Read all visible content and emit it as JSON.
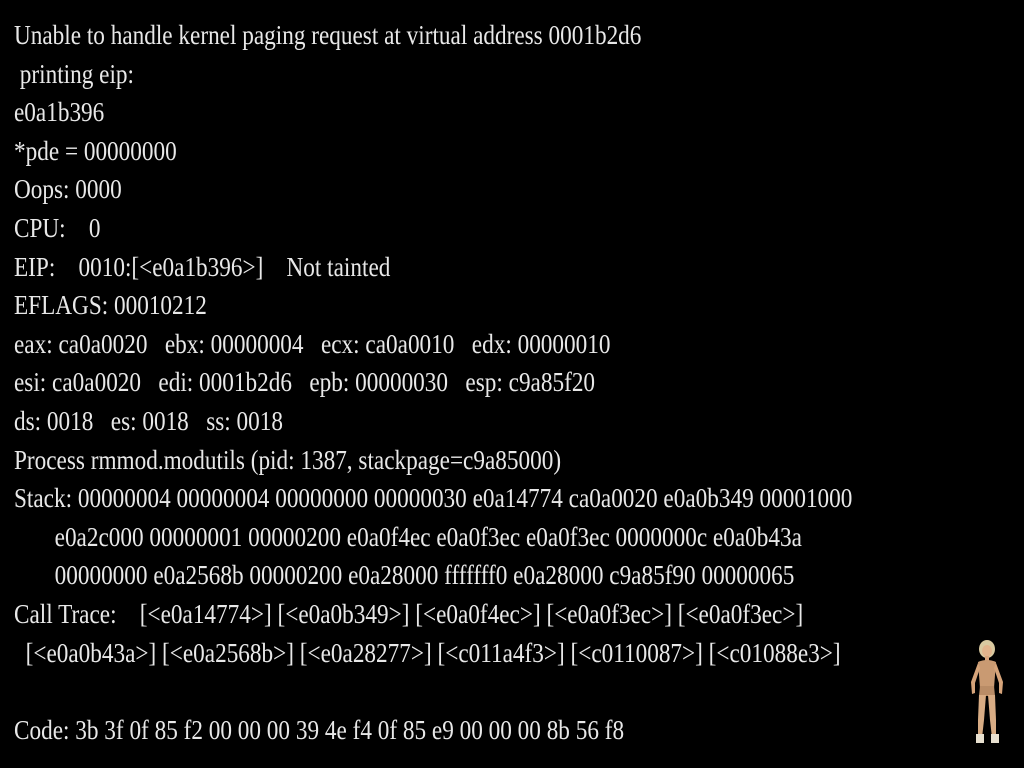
{
  "console": {
    "lines": [
      "Unable to handle kernel paging request at virtual address 0001b2d6",
      " printing eip:",
      "e0a1b396",
      "*pde = 00000000",
      "Oops: 0000",
      "CPU:    0",
      "EIP:    0010:[<e0a1b396>]    Not tainted",
      "EFLAGS: 00010212",
      "eax: ca0a0020   ebx: 00000004   ecx: ca0a0010   edx: 00000010",
      "esi: ca0a0020   edi: 0001b2d6   epb: 00000030   esp: c9a85f20",
      "ds: 0018   es: 0018   ss: 0018",
      "Process rmmod.modutils (pid: 1387, stackpage=c9a85000)",
      "Stack: 00000004 00000004 00000000 00000030 e0a14774 ca0a0020 e0a0b349 00001000",
      "       e0a2c000 00000001 00000200 e0a0f4ec e0a0f3ec e0a0f3ec 0000000c e0a0b43a",
      "       00000000 e0a2568b 00000200 e0a28000 fffffff0 e0a28000 c9a85f90 00000065",
      "Call Trace:    [<e0a14774>] [<e0a0b349>] [<e0a0f4ec>] [<e0a0f3ec>] [<e0a0f3ec>]",
      "  [<e0a0b43a>] [<e0a2568b>] [<e0a28277>] [<c011a4f3>] [<c0110087>] [<c01088e3>]",
      "",
      "Code: 3b 3f 0f 85 f2 00 00 00 39 4e f4 0f 85 e9 00 00 00 8b 56 f8"
    ]
  },
  "overlay": {
    "icon": "standing-person-figure"
  },
  "colors": {
    "background": "#000000",
    "text": "#e8e8e8"
  }
}
